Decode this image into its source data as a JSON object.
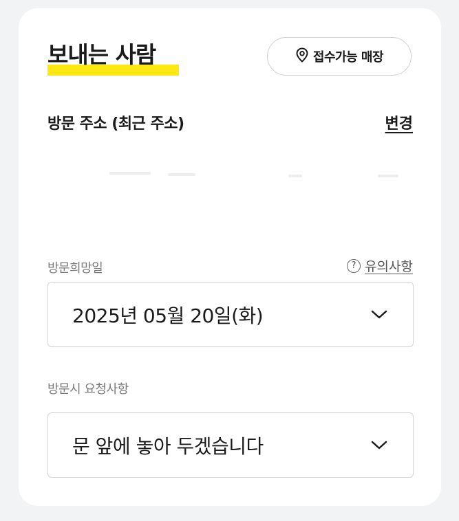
{
  "header": {
    "title": "보내는 사람",
    "store_button_label": "접수가능 매장",
    "highlight_color": "#ffe812"
  },
  "address_section": {
    "label": "방문 주소 (최근 주소)",
    "change_label": "변경"
  },
  "visit_date": {
    "label": "방문희망일",
    "notice_label": "유의사항",
    "notice_icon": "question-circle-icon",
    "selected_value": "2025년 05월 20일(화)"
  },
  "visit_request": {
    "label": "방문시 요청사항",
    "selected_value": "문 앞에 놓아 두겠습니다"
  }
}
